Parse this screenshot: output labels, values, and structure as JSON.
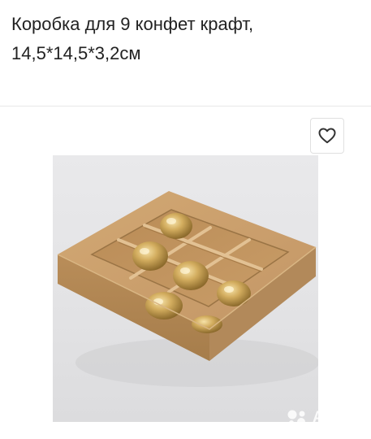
{
  "listing": {
    "title": "Коробка для 9 конфет крафт, 14,5*14,5*3,2см"
  },
  "actions": {
    "favorite_icon": "heart-outline-icon"
  },
  "photo": {
    "subject": "kraft-box-9-candies",
    "watermark_text": "Avito",
    "watermark_logo": "avito-dots-logo"
  },
  "colors": {
    "kraft": "#c99e6c",
    "kraft_dark": "#a9804f",
    "gold": "#c9a35a",
    "text": "#222222",
    "background": "#e6e6e8"
  }
}
